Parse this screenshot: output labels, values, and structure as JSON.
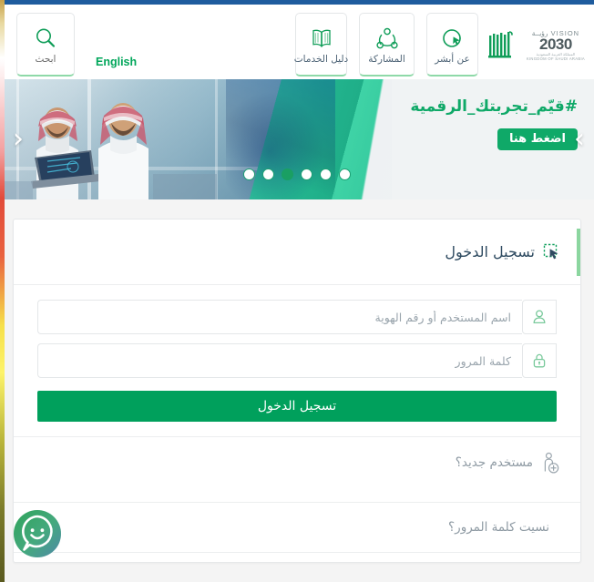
{
  "theme": {
    "top_bar_color": "#1f5c9e",
    "primary_green": "#00a05c",
    "banner_green": "#0fa968",
    "accent_light_green": "#8bd69f",
    "title_navy": "#2f4b61",
    "muted_text": "#8e9aa3",
    "page_background": "#f4f4f4"
  },
  "header": {
    "search_tile": {
      "label": "ابحث",
      "icon": "search-icon"
    },
    "language_link": "English",
    "nav_tiles": [
      {
        "label": "دليل الخدمات",
        "icon": "book-icon"
      },
      {
        "label": "المشاركة",
        "icon": "share-network-icon"
      },
      {
        "label": "عن أبشر",
        "icon": "cursor-circle-icon"
      }
    ],
    "brand": {
      "vision_word": "VISION",
      "vision_word_ar": "رؤيــة",
      "vision_year": "2030",
      "vision_sub_ar": "المملكة العربية السعودية",
      "vision_sub_en": "KINGDOM OF SAUDI ARABIA",
      "absher_logo": "absher-logo"
    }
  },
  "banner": {
    "headline": "#قيّم_تجربتك_الرقمية",
    "cta_label": "اضغط هنا",
    "prev_label": "‹",
    "next_label": "›",
    "slide_count": 6,
    "active_slide": 4
  },
  "login_card": {
    "title": "تسجيل الدخول",
    "title_icon": "select-cursor-icon",
    "username": {
      "placeholder": "اسم المستخدم أو رقم الهوية",
      "value": "",
      "icon": "user-icon"
    },
    "password": {
      "placeholder": "كلمة المرور",
      "value": "",
      "icon": "lock-icon"
    },
    "submit_label": "تسجيل الدخول",
    "new_user": {
      "label": "مستخدم جديد؟",
      "icon": "add-user-icon"
    },
    "forgot_password": {
      "label": "نسيت كلمة المرور؟"
    }
  },
  "chat_widget": {
    "icon": "chat-smiley-icon",
    "label": ""
  }
}
